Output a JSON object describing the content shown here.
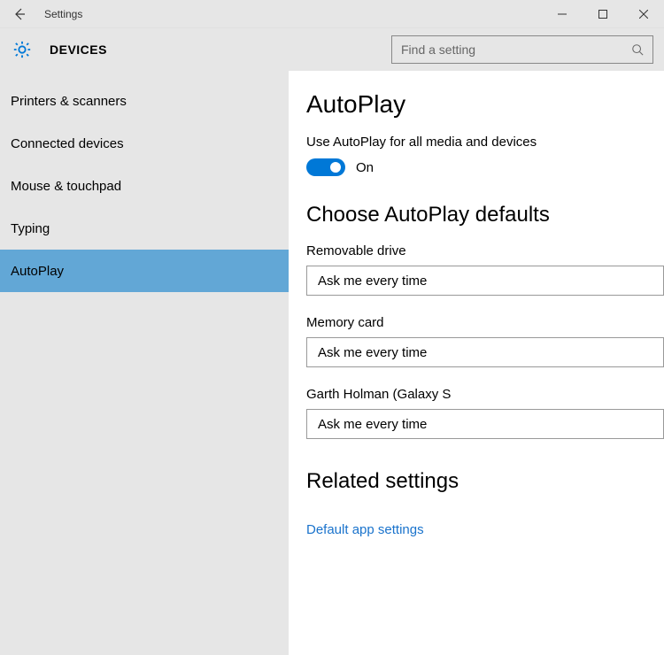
{
  "window": {
    "title": "Settings"
  },
  "header": {
    "section": "DEVICES",
    "search_placeholder": "Find a setting"
  },
  "sidebar": {
    "items": [
      {
        "label": "Printers & scanners",
        "selected": false
      },
      {
        "label": "Connected devices",
        "selected": false
      },
      {
        "label": "Mouse & touchpad",
        "selected": false
      },
      {
        "label": "Typing",
        "selected": false
      },
      {
        "label": "AutoPlay",
        "selected": true
      }
    ]
  },
  "main": {
    "title": "AutoPlay",
    "toggle_label": "Use AutoPlay for all media and devices",
    "toggle_state": "On",
    "defaults_title": "Choose AutoPlay defaults",
    "fields": [
      {
        "label": "Removable drive",
        "value": "Ask me every time"
      },
      {
        "label": "Memory card",
        "value": "Ask me every time"
      },
      {
        "label": "Garth Holman (Galaxy S",
        "value": "Ask me every time"
      }
    ],
    "related_title": "Related settings",
    "related_link": "Default app settings"
  }
}
